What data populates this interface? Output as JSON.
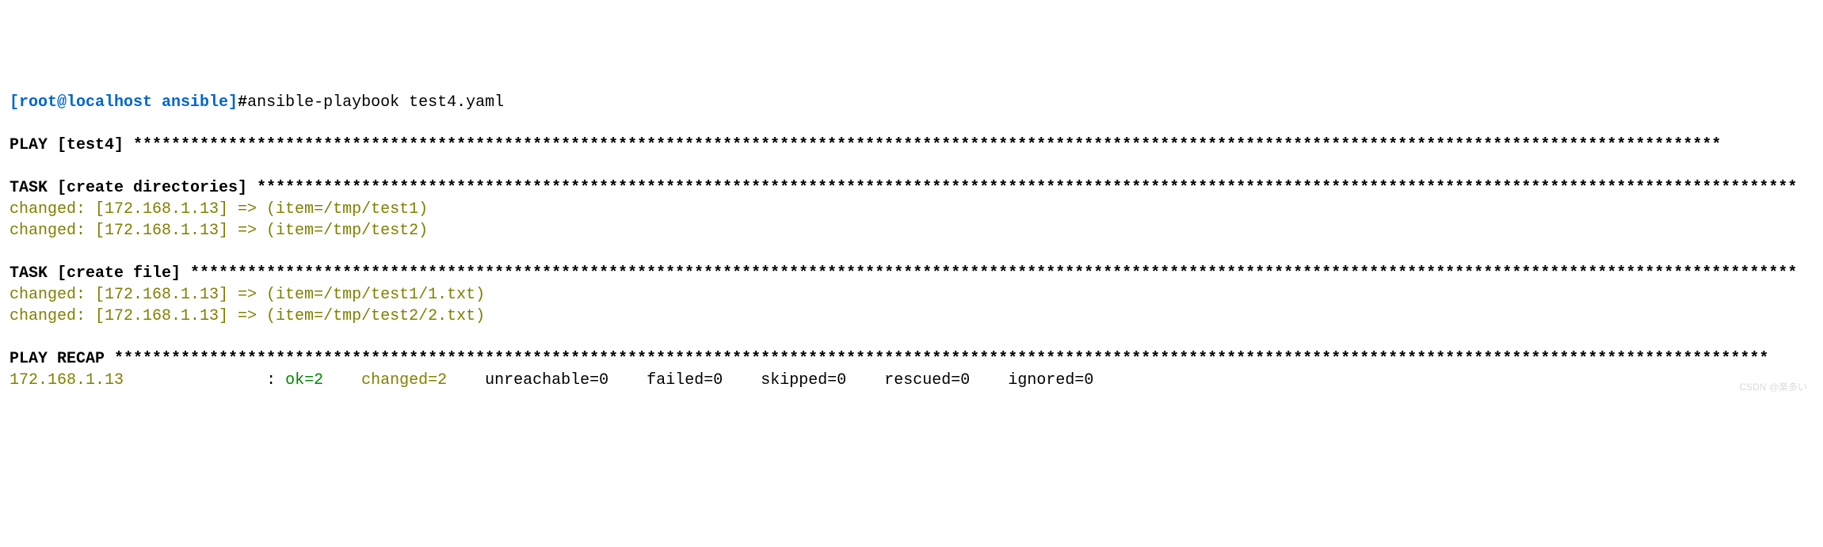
{
  "prompt": {
    "user_host": "[root@localhost ansible]",
    "symbol": "#",
    "command": "ansible-playbook test4.yaml"
  },
  "play_header": {
    "label": "PLAY [test4] ",
    "stars": "***********************************************************************************************************************************************************************"
  },
  "task1": {
    "header_label": "TASK [create directories] ",
    "header_stars": "******************************************************************************************************************************************************************",
    "lines": [
      "changed: [172.168.1.13] => (item=/tmp/test1)",
      "changed: [172.168.1.13] => (item=/tmp/test2)"
    ]
  },
  "task2": {
    "header_label": "TASK [create file] ",
    "header_stars": "*************************************************************************************************************************************************************************",
    "lines": [
      "changed: [172.168.1.13] => (item=/tmp/test1/1.txt)",
      "changed: [172.168.1.13] => (item=/tmp/test2/2.txt)"
    ]
  },
  "recap": {
    "header_label": "PLAY RECAP ",
    "header_stars": "******************************************************************************************************************************************************************************",
    "host": "172.168.1.13",
    "host_pad": "               ",
    "sep": ": ",
    "ok": "ok=2",
    "pad1": "    ",
    "changed": "changed=2",
    "pad2": "    ",
    "unreachable": "unreachable=0",
    "pad3": "    ",
    "failed": "failed=0",
    "pad4": "    ",
    "skipped": "skipped=0",
    "pad5": "    ",
    "rescued": "rescued=0",
    "pad6": "    ",
    "ignored": "ignored=0"
  },
  "watermark": "CSDN @楽多い"
}
